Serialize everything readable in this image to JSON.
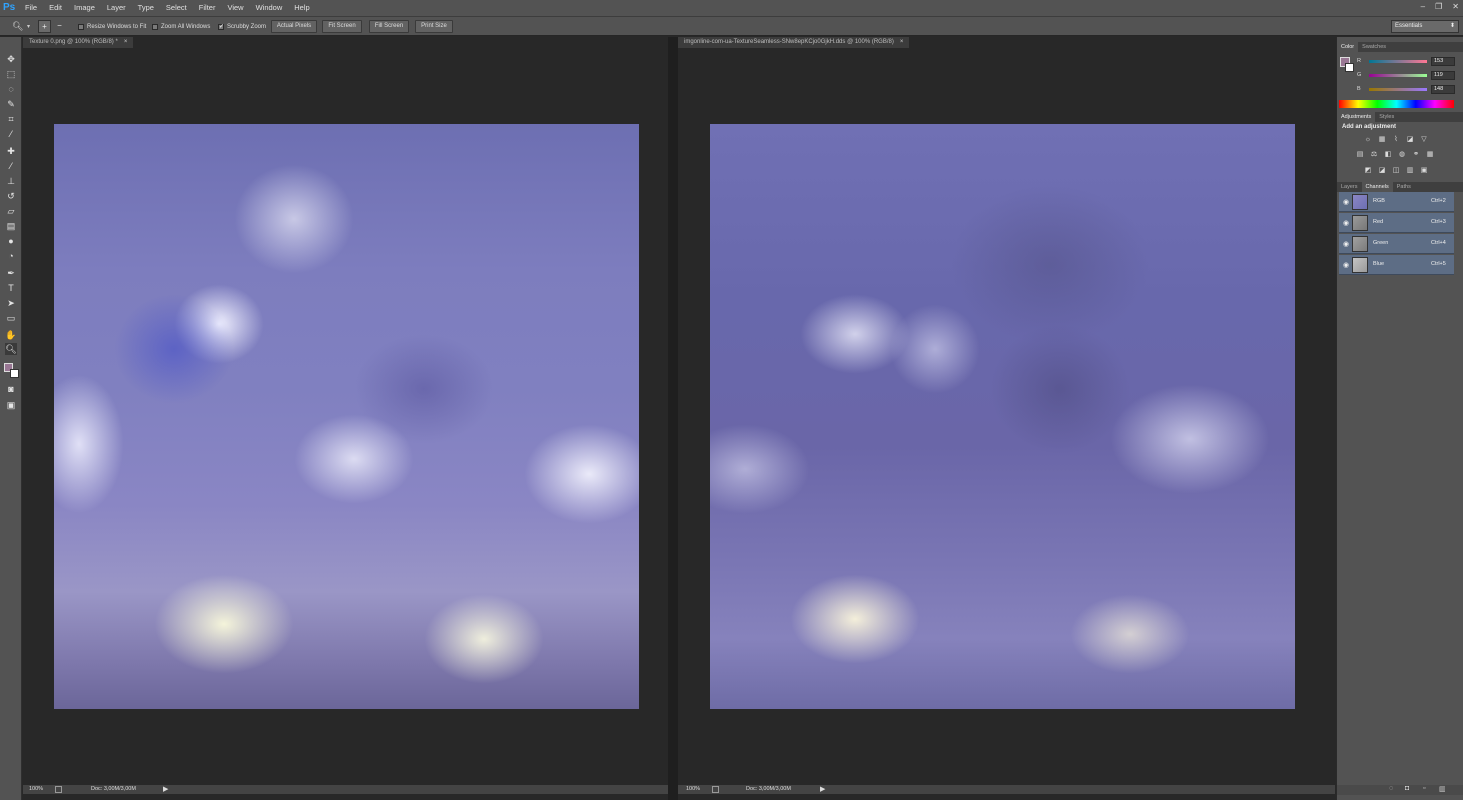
{
  "app": {
    "logo": "Ps"
  },
  "menu": [
    "File",
    "Edit",
    "Image",
    "Layer",
    "Type",
    "Select",
    "Filter",
    "View",
    "Window",
    "Help"
  ],
  "window_controls": [
    "–",
    "❐",
    "✕"
  ],
  "options": {
    "resize_windows": "Resize Windows to Fit",
    "zoom_all": "Zoom All Windows",
    "scrubby_zoom": "Scrubby Zoom",
    "actual_pixels": "Actual Pixels",
    "fit_screen": "Fit Screen",
    "fill_screen": "Fill Screen",
    "print_size": "Print Size",
    "workspace": "Essentials"
  },
  "doc_left": {
    "tab": "Texture 0.png @ 100% (RGB/8) *",
    "zoom": "100%",
    "doc_size": "Doc: 3,00M/3,00M"
  },
  "doc_right": {
    "tab": "imgonline-com-ua-TextureSeamless-SNw8epKCjo0GjkH.dds @ 100% (RGB/8)",
    "zoom": "100%",
    "doc_size": "Doc: 3,00M/3,00M"
  },
  "color_panel": {
    "tabs": [
      "Color",
      "Swatches"
    ],
    "r_label": "R",
    "r": "153",
    "g_label": "G",
    "g": "119",
    "b_label": "B",
    "b": "148",
    "foreground": "#997794"
  },
  "adjustments": {
    "tabs": [
      "Adjustments",
      "Styles"
    ],
    "heading": "Add an adjustment"
  },
  "channels_panel": {
    "tabs": [
      "Layers",
      "Channels",
      "Paths"
    ],
    "rows": [
      {
        "name": "RGB",
        "shortcut": "Ctrl+2"
      },
      {
        "name": "Red",
        "shortcut": "Ctrl+3"
      },
      {
        "name": "Green",
        "shortcut": "Ctrl+4"
      },
      {
        "name": "Blue",
        "shortcut": "Ctrl+5"
      }
    ]
  }
}
